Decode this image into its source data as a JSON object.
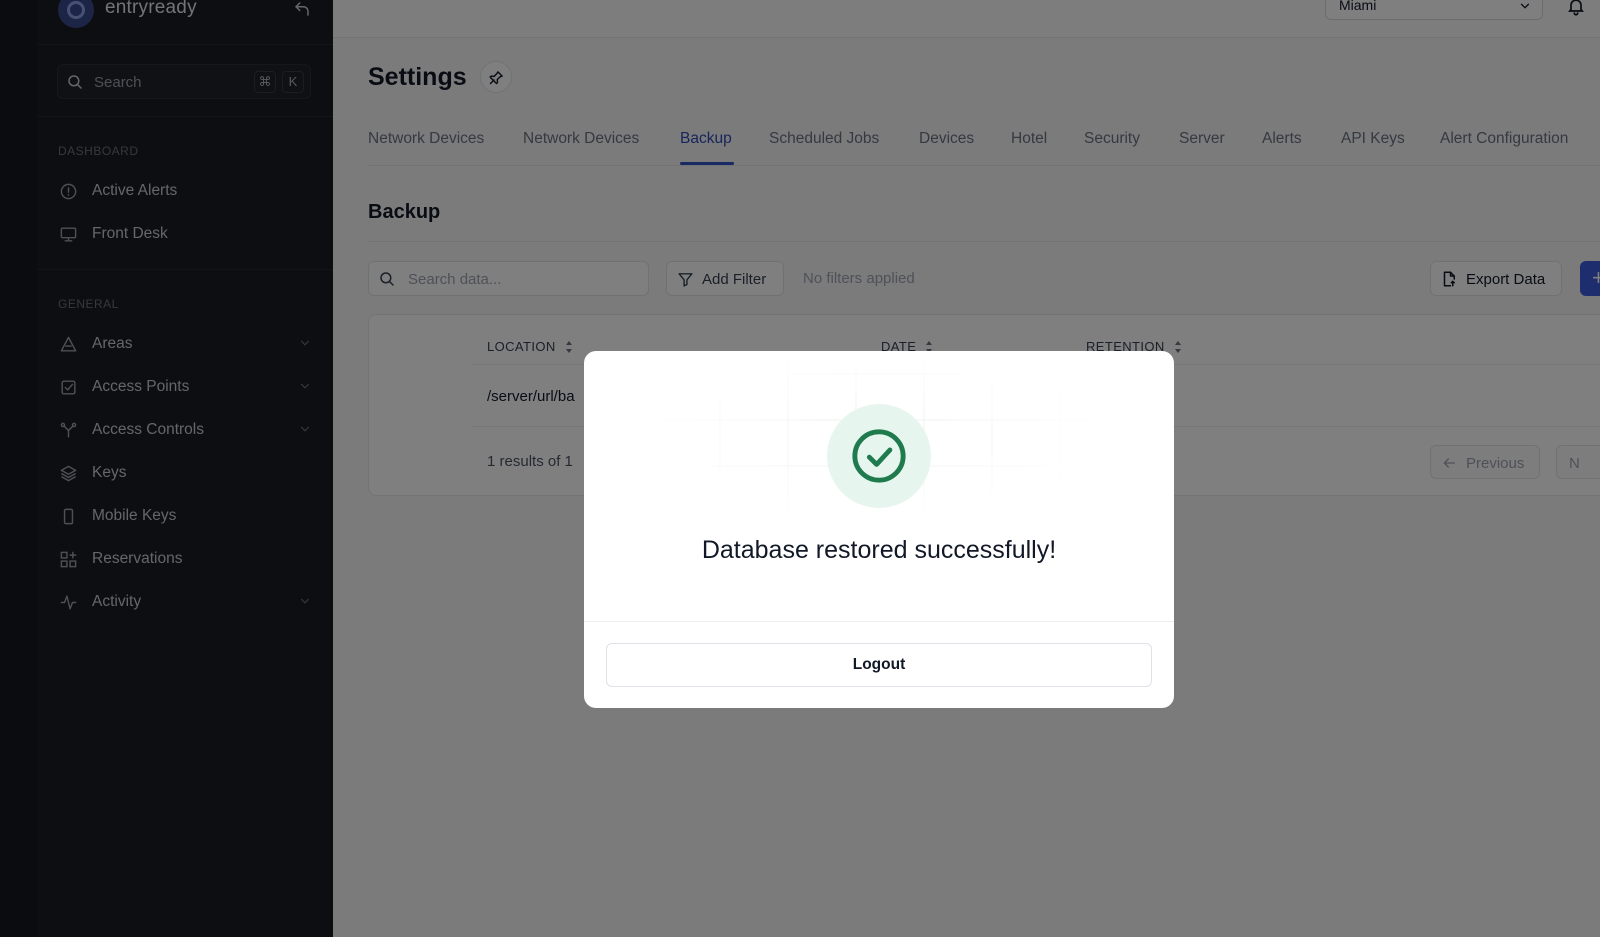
{
  "app": {
    "name": "entryready"
  },
  "sidebar": {
    "search": {
      "label": "Search",
      "kbd_cmd": "⌘",
      "kbd_key": "K"
    },
    "sections": [
      {
        "title": "DASHBOARD",
        "items": [
          {
            "label": "Active Alerts",
            "icon": "alert-circle-icon"
          },
          {
            "label": "Front Desk",
            "icon": "monitor-icon"
          }
        ]
      },
      {
        "title": "GENERAL",
        "items": [
          {
            "label": "Areas",
            "icon": "areas-icon",
            "expandable": true
          },
          {
            "label": "Access Points",
            "icon": "access-points-icon",
            "expandable": true
          },
          {
            "label": "Access Controls",
            "icon": "access-controls-icon",
            "expandable": true
          },
          {
            "label": "Keys",
            "icon": "layers-icon",
            "expandable": false
          },
          {
            "label": "Mobile Keys",
            "icon": "smartphone-icon",
            "expandable": false
          },
          {
            "label": "Reservations",
            "icon": "grid-plus-icon",
            "expandable": false
          },
          {
            "label": "Activity",
            "icon": "activity-icon",
            "expandable": true
          }
        ]
      }
    ]
  },
  "topbar": {
    "location": "Miami"
  },
  "page": {
    "title": "Settings",
    "tabs": [
      {
        "label": "Network Devices"
      },
      {
        "label": "Network Devices"
      },
      {
        "label": "Backup",
        "active": true
      },
      {
        "label": "Scheduled Jobs"
      },
      {
        "label": "Devices"
      },
      {
        "label": "Hotel"
      },
      {
        "label": "Security"
      },
      {
        "label": "Server"
      },
      {
        "label": "Alerts"
      },
      {
        "label": "API Keys"
      },
      {
        "label": "Alert Configuration"
      }
    ],
    "section_title": "Backup",
    "toolbar": {
      "search_placeholder": "Search data...",
      "add_filter": "Add Filter",
      "filter_status": "No filters applied",
      "export": "Export Data",
      "add": "+"
    },
    "table": {
      "columns": [
        "LOCATION",
        "DATE",
        "RETENTION"
      ],
      "rows": [
        {
          "location": "/server/url/ba"
        }
      ],
      "results": "1 results of 1",
      "previous": "Previous",
      "next": "N"
    }
  },
  "modal": {
    "message": "Database restored successfully!",
    "button": "Logout"
  },
  "colors": {
    "accent": "#3352c8",
    "success": "#1f7a4d",
    "sidebar_bg": "#1a1d24"
  }
}
